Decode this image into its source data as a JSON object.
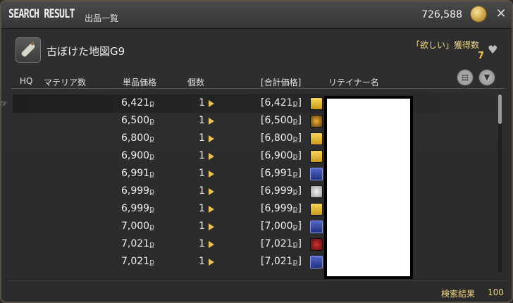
{
  "window": {
    "title": "SEARCH RESULT",
    "subtitle": "出品一覧",
    "gil": "726,588"
  },
  "item": {
    "name": "古ぼけた地図G9",
    "wanted_label": "「欲しい」獲得数",
    "wanted_count": "7"
  },
  "columns": {
    "hq": "HQ",
    "materia": "マテリア数",
    "unit_price": "単品価格",
    "quantity": "個数",
    "total": "[合計価格]",
    "retainer": "リテイナー名"
  },
  "currency_symbol": "ք",
  "listings": [
    {
      "unit_price": "6,421",
      "qty": "1",
      "total": "6,421",
      "city": "gold"
    },
    {
      "unit_price": "6,500",
      "qty": "1",
      "total": "6,500",
      "city": "amber"
    },
    {
      "unit_price": "6,800",
      "qty": "1",
      "total": "6,800",
      "city": "gold"
    },
    {
      "unit_price": "6,900",
      "qty": "1",
      "total": "6,900",
      "city": "gold"
    },
    {
      "unit_price": "6,991",
      "qty": "1",
      "total": "6,991",
      "city": "blue"
    },
    {
      "unit_price": "6,999",
      "qty": "1",
      "total": "6,999",
      "city": "white"
    },
    {
      "unit_price": "6,999",
      "qty": "1",
      "total": "6,999",
      "city": "gold"
    },
    {
      "unit_price": "7,000",
      "qty": "1",
      "total": "7,000",
      "city": "blue"
    },
    {
      "unit_price": "7,021",
      "qty": "1",
      "total": "7,021",
      "city": "red"
    },
    {
      "unit_price": "7,021",
      "qty": "1",
      "total": "7,021",
      "city": "blue"
    }
  ],
  "footer": {
    "result_label": "検索結果",
    "result_count": "100"
  }
}
